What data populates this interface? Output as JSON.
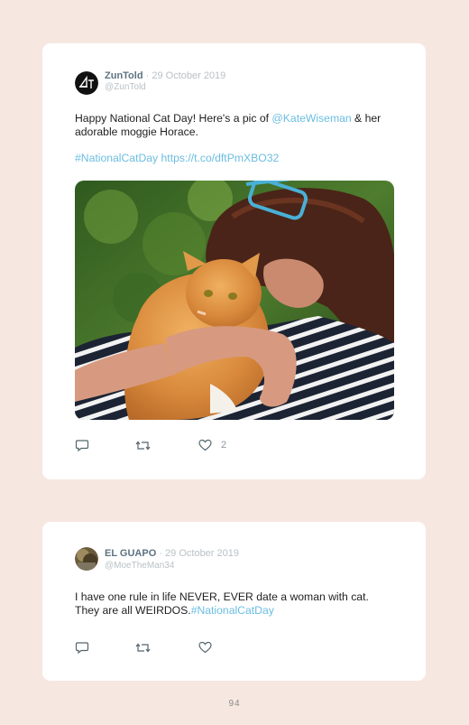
{
  "tweets": [
    {
      "name": "ZunTold",
      "date": "· 29 October 2019",
      "username": "@ZunTold",
      "text_part1": "Happy National Cat Day! Here's a pic of ",
      "mention": "@KateWiseman",
      "text_part2": " & her adorable moggie Horace.",
      "hashtag": "#NationalCatDay",
      "link": "https://t.co/dftPmXBO32",
      "photo": "photo of a woman with a striped top and blue glasses hugging a ginger and white cat",
      "likes": "2"
    },
    {
      "name": "EL GUAPO",
      "date": "· 29 October 2019",
      "username": "@MoeTheMan34",
      "text_part1": "I have one rule in life NEVER, EVER date a woman with cat. They are all WEIRDOS.",
      "hashtag": "#NationalCatDay",
      "likes": ""
    }
  ],
  "page_number": "94",
  "colors": {
    "background": "#f6e8e0",
    "link": "#6bbde0",
    "name": "#5d7380"
  }
}
